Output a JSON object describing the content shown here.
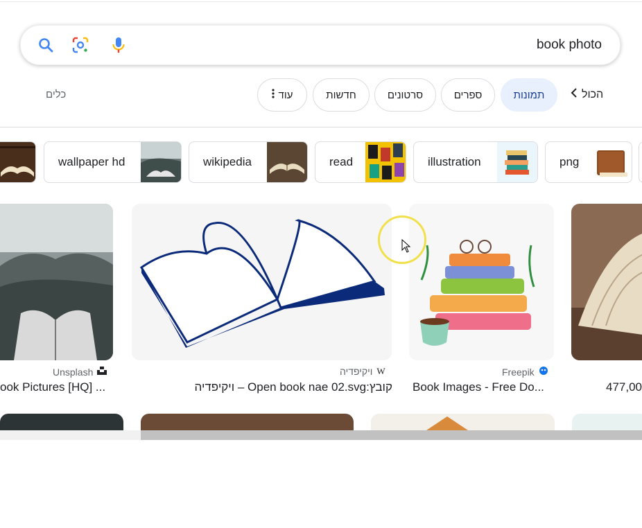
{
  "search": {
    "query": "book photo"
  },
  "chips": {
    "all": "הכול",
    "images": "תמונות",
    "books": "ספרים",
    "videos": "סרטונים",
    "news": "חדשות",
    "more": "עוד",
    "tools": "כלים"
  },
  "related": [
    {
      "label": "png"
    },
    {
      "label": "illustration"
    },
    {
      "label": "read"
    },
    {
      "label": "wikipedia"
    },
    {
      "label": "wallpaper hd"
    }
  ],
  "results": [
    {
      "source": "Unsplash",
      "title": "ook Pictures [HQ] ..."
    },
    {
      "source": "ויקיפדיה",
      "title": "קובץ:Open book nae 02.svg – ויקיפדיה"
    },
    {
      "source": "Freepik",
      "title": "Book Images - Free Do..."
    },
    {
      "source": "",
      "title": "477,00"
    }
  ],
  "colors": {
    "accent": "#1a73e8",
    "selected_chip": "#e8f0fe"
  }
}
